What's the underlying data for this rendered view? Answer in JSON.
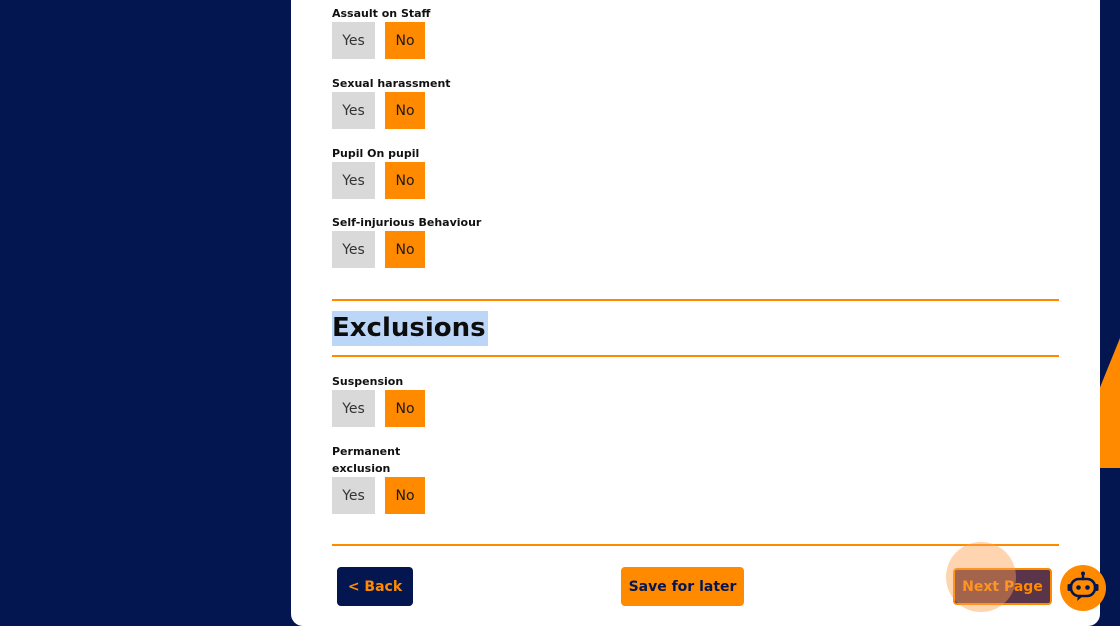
{
  "questions": [
    {
      "label": "Assault on Staff",
      "yes": "Yes",
      "no": "No"
    },
    {
      "label": "Sexual harassment",
      "yes": "Yes",
      "no": "No"
    },
    {
      "label": "Pupil On pupil",
      "yes": "Yes",
      "no": "No"
    },
    {
      "label": "Self-injurious Behaviour",
      "yes": "Yes",
      "no": "No"
    }
  ],
  "exclusions": {
    "title": "Exclusions",
    "questions": [
      {
        "label": "Suspension",
        "yes": "Yes",
        "no": "No"
      },
      {
        "label_line1": "Permanent",
        "label_line2": "exclusion",
        "yes": "Yes",
        "no": "No"
      }
    ]
  },
  "footer": {
    "back_label": "< Back",
    "save_label": "Save for later",
    "next_label": "Next Page"
  },
  "colors": {
    "navy": "#041650",
    "accent": "#ff8a00",
    "unselected": "#d9d9d9",
    "selection_highlight": "#bcd6f7"
  },
  "icons": {
    "chat": "robot-assistant-icon"
  }
}
